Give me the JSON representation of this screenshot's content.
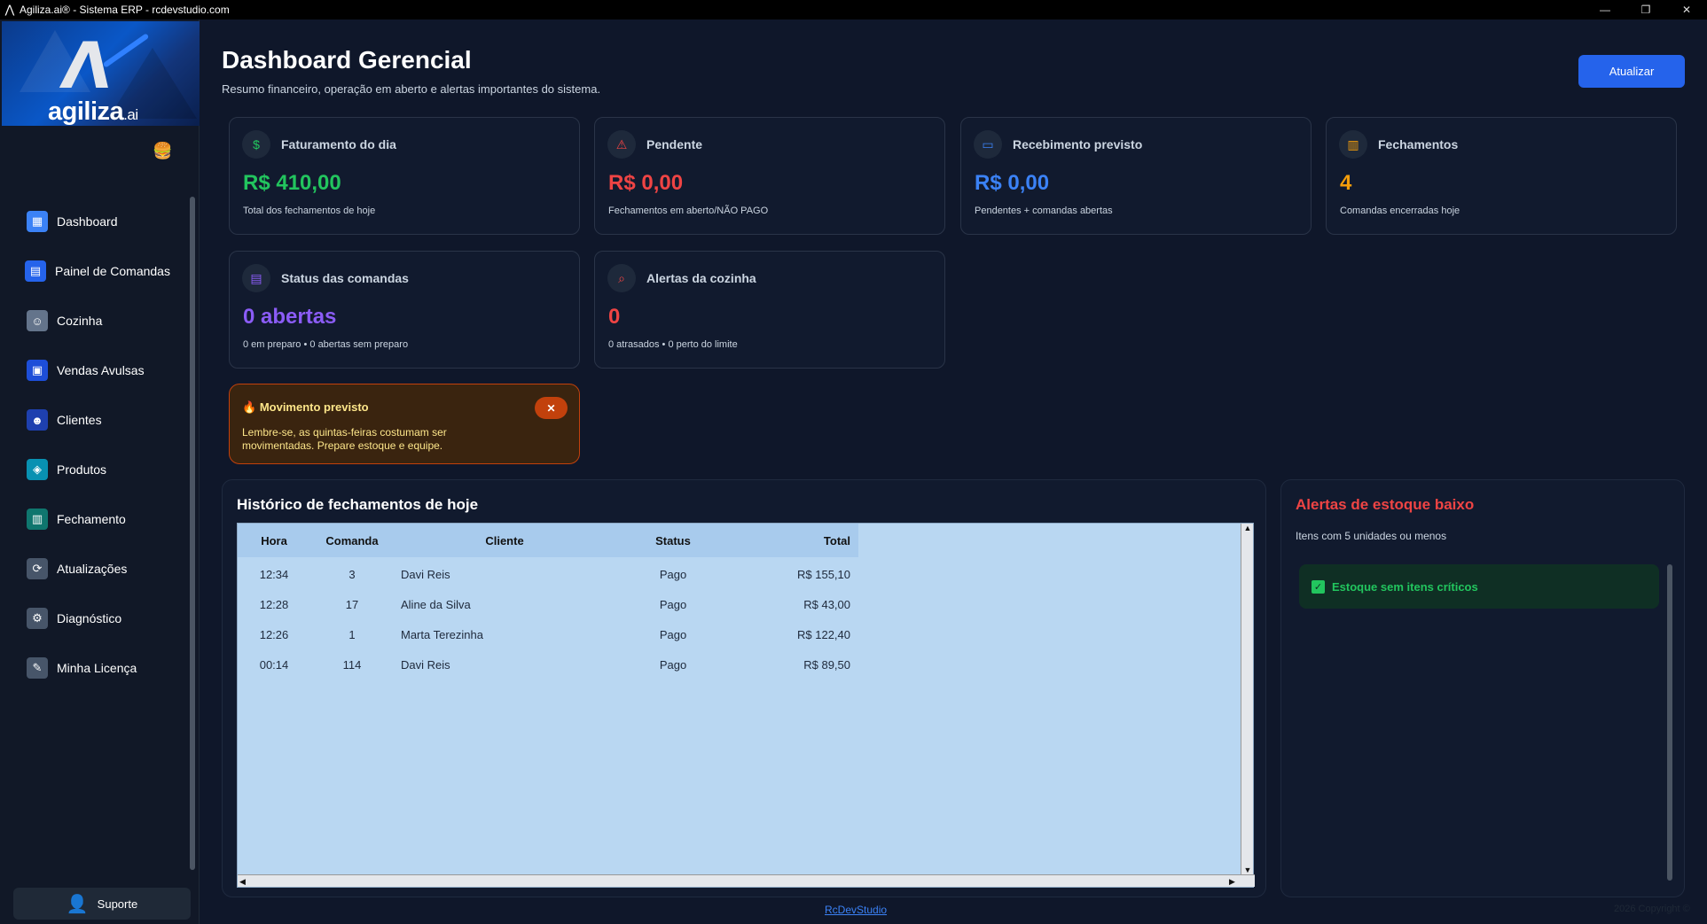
{
  "window": {
    "title": "Agiliza.ai® - Sistema ERP - rcdevstudio.com",
    "controls": [
      "—",
      "❐",
      "✕"
    ]
  },
  "brand": {
    "name": "agiliza",
    "suffix": ".ai"
  },
  "sidebar": {
    "items": [
      {
        "label": "Dashboard",
        "icon": "dashboard-icon",
        "color": "#3b82f6"
      },
      {
        "label": "Painel de Comandas",
        "icon": "orders-panel-icon",
        "color": "#2563eb"
      },
      {
        "label": "Cozinha",
        "icon": "kitchen-icon",
        "color": "#64748b"
      },
      {
        "label": "Vendas Avulsas",
        "icon": "sales-icon",
        "color": "#1d4ed8"
      },
      {
        "label": "Clientes",
        "icon": "clients-icon",
        "color": "#1e40af"
      },
      {
        "label": "Produtos",
        "icon": "products-icon",
        "color": "#0891b2"
      },
      {
        "label": "Fechamento",
        "icon": "closing-icon",
        "color": "#0f766e"
      },
      {
        "label": "Atualizações",
        "icon": "updates-icon",
        "color": "#475569"
      },
      {
        "label": "Diagnóstico",
        "icon": "diagnostic-icon",
        "color": "#475569"
      },
      {
        "label": "Minha Licença",
        "icon": "license-icon",
        "color": "#475569"
      }
    ],
    "support_label": "Suporte"
  },
  "header": {
    "title": "Dashboard Gerencial",
    "subtitle": "Resumo financeiro, operação em aberto e alertas importantes do sistema.",
    "refresh_label": "Atualizar"
  },
  "cards": [
    {
      "title": "Faturamento do dia",
      "value": "R$ 410,00",
      "desc": "Total dos fechamentos de hoje",
      "color": "#22c55e",
      "icon": "money-icon"
    },
    {
      "title": "Pendente",
      "value": "R$ 0,00",
      "desc": "Fechamentos em aberto/NÃO PAGO",
      "color": "#ef4444",
      "icon": "warning-icon"
    },
    {
      "title": "Recebimento previsto",
      "value": "R$ 0,00",
      "desc": "Pendentes + comandas abertas",
      "color": "#3b82f6",
      "icon": "card-icon"
    },
    {
      "title": "Fechamentos",
      "value": "4",
      "desc": "Comandas encerradas hoje",
      "color": "#f59e0b",
      "icon": "chart-icon"
    },
    {
      "title": "Status das comandas",
      "value": "0 abertas",
      "desc": "0 em preparo • 0 abertas sem preparo",
      "color": "#8b5cf6",
      "icon": "receipt-icon"
    },
    {
      "title": "Alertas da cozinha",
      "value": "0",
      "desc": "0 atrasados • 0 perto do limite",
      "color": "#ef4444",
      "icon": "alert-search-icon"
    }
  ],
  "notice": {
    "title": "Movimento previsto",
    "text": "Lembre-se, as quintas-feiras costumam ser movimentadas. Prepare estoque e equipe.",
    "close_label": "✕"
  },
  "history": {
    "title": "Histórico de fechamentos de hoje",
    "columns": [
      "Hora",
      "Comanda",
      "Cliente",
      "Status",
      "Total"
    ],
    "rows": [
      {
        "hora": "12:34",
        "comanda": "3",
        "cliente": "Davi Reis",
        "status": "Pago",
        "total": "R$ 155,10"
      },
      {
        "hora": "12:28",
        "comanda": "17",
        "cliente": "Aline da Silva",
        "status": "Pago",
        "total": "R$ 43,00"
      },
      {
        "hora": "12:26",
        "comanda": "1",
        "cliente": "Marta Terezinha",
        "status": "Pago",
        "total": "R$ 122,40"
      },
      {
        "hora": "00:14",
        "comanda": "114",
        "cliente": "Davi Reis",
        "status": "Pago",
        "total": "R$ 89,50"
      }
    ]
  },
  "stock": {
    "title": "Alertas de estoque baixo",
    "subtitle": "Itens com 5 unidades ou menos",
    "ok_message": "Estoque sem itens críticos"
  },
  "footer": {
    "link": "RcDevStudio",
    "copyright": "2026 Copyright ©"
  }
}
